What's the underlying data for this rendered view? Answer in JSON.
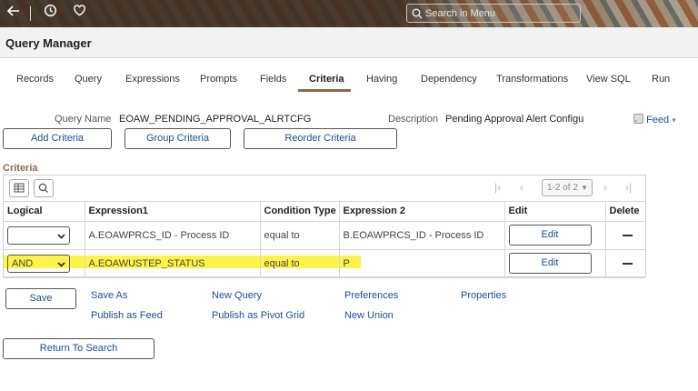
{
  "header": {
    "search_placeholder": "Search in Menu",
    "icons": [
      "back-arrow-icon",
      "history-clock-icon",
      "favorites-heart-icon",
      "search-icon"
    ]
  },
  "page": {
    "title": "Query Manager"
  },
  "tabs": [
    {
      "label": "Records"
    },
    {
      "label": "Query"
    },
    {
      "label": "Expressions"
    },
    {
      "label": "Prompts"
    },
    {
      "label": "Fields"
    },
    {
      "label": "Criteria",
      "active": true
    },
    {
      "label": "Having"
    },
    {
      "label": "Dependency"
    },
    {
      "label": "Transformations"
    },
    {
      "label": "View SQL"
    },
    {
      "label": "Run"
    }
  ],
  "query": {
    "name_label": "Query Name",
    "name_value": "EOAW_PENDING_APPROVAL_ALRTCFG",
    "description_label": "Description",
    "description_value": "Pending Approval Alert Configu",
    "feed_label": "Feed"
  },
  "actions": {
    "add_criteria": "Add Criteria",
    "group_criteria": "Group Criteria",
    "reorder_criteria": "Reorder Criteria"
  },
  "criteria": {
    "section_title": "Criteria",
    "pager_text": "1-2 of 2",
    "columns": [
      "Logical",
      "Expression1",
      "Condition Type",
      "Expression 2",
      "Edit",
      "Delete"
    ],
    "rows": [
      {
        "logical": "",
        "expression1": "A.EOAWPRCS_ID - Process ID",
        "condition": "equal to",
        "expression2": "B.EOAWPRCS_ID - Process ID",
        "edit": "Edit"
      },
      {
        "logical": "AND",
        "expression1": "A.EOAWUSTEP_STATUS",
        "condition": "equal to",
        "expression2": "P",
        "edit": "Edit",
        "highlighted": true
      }
    ]
  },
  "footer": {
    "save": "Save",
    "save_as": "Save As",
    "new_query": "New Query",
    "preferences": "Preferences",
    "properties": "Properties",
    "publish_as_feed": "Publish as Feed",
    "publish_as_pivot_grid": "Publish as Pivot Grid",
    "new_union": "New Union",
    "return_to_search": "Return To Search"
  },
  "colors": {
    "link": "#1d4f8c",
    "highlight": "#fff34a",
    "tab_underline": "#8a6a52"
  }
}
